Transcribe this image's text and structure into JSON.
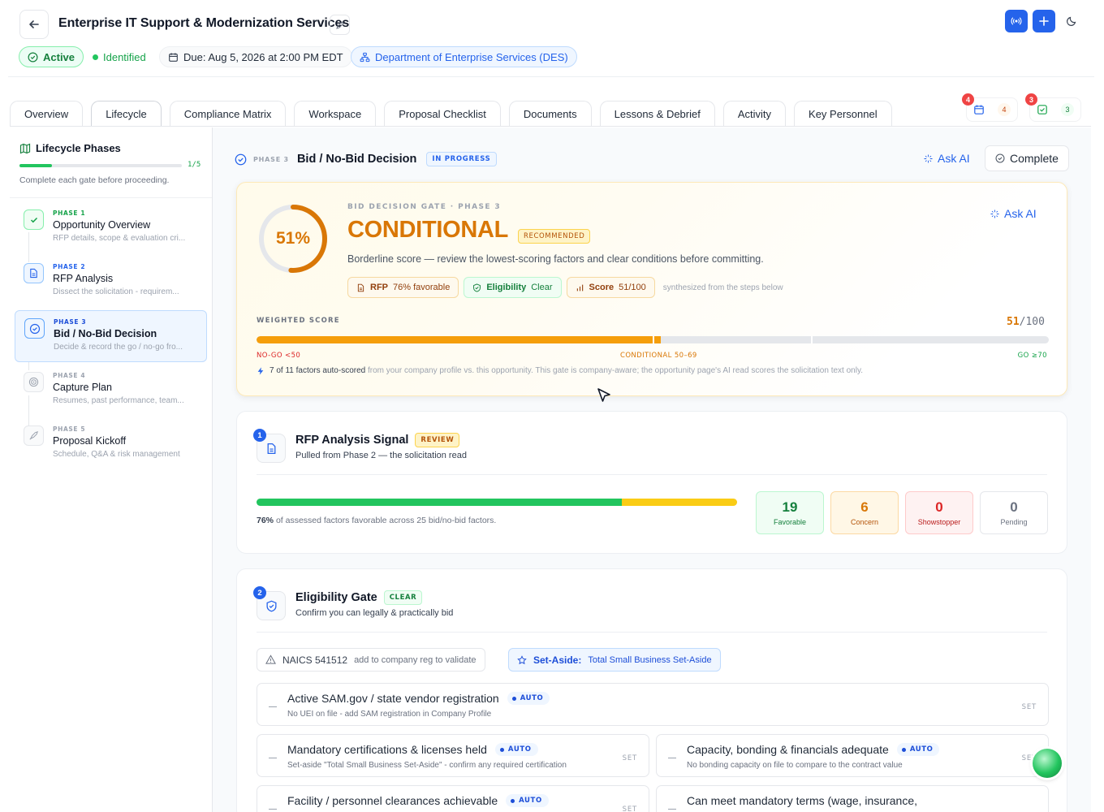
{
  "header": {
    "title": "Enterprise IT Support & Modernization Services",
    "status_active": "Active",
    "status_identified": "Identified",
    "due": "Due: Aug 5, 2026 at 2:00 PM EDT",
    "agency": "Department of Enterprise Services (DES)"
  },
  "tabs": [
    {
      "label": "Overview"
    },
    {
      "label": "Lifecycle",
      "active": true
    },
    {
      "label": "Compliance Matrix"
    },
    {
      "label": "Workspace"
    },
    {
      "label": "Proposal Checklist"
    },
    {
      "label": "Documents"
    },
    {
      "label": "Lessons & Debrief"
    },
    {
      "label": "Activity"
    },
    {
      "label": "Key Personnel"
    }
  ],
  "toolbar": {
    "calendar_badge": "4",
    "calendar_count": "4",
    "tasks_badge": "3",
    "tasks_count": "3"
  },
  "sidebar": {
    "title": "Lifecycle Phases",
    "progress_label": "1/5",
    "progress_fraction": 0.2,
    "hint": "Complete each gate before proceeding.",
    "phases": [
      {
        "num": "PHASE 1",
        "name": "Opportunity Overview",
        "desc": "RFP details, scope & evaluation cri...",
        "state": "done"
      },
      {
        "num": "PHASE 2",
        "name": "RFP Analysis",
        "desc": "Dissect the solicitation - requirem...",
        "state": "active"
      },
      {
        "num": "PHASE 3",
        "name": "Bid / No-Bid Decision",
        "desc": "Decide & record the go / no-go fro...",
        "state": "selected"
      },
      {
        "num": "PHASE 4",
        "name": "Capture Plan",
        "desc": "Resumes, past performance, team...",
        "state": "pending"
      },
      {
        "num": "PHASE 5",
        "name": "Proposal Kickoff",
        "desc": "Schedule, Q&A & risk management",
        "state": "pending"
      }
    ]
  },
  "main": {
    "phase_tag": "PHASE 3",
    "title": "Bid / No-Bid Decision",
    "status_badge": "IN PROGRESS",
    "ask_ai": "Ask AI",
    "complete": "Complete"
  },
  "gate": {
    "score_pct": 51,
    "score_label": "51%",
    "eyebrow": "BID DECISION GATE · PHASE 3",
    "verdict": "CONDITIONAL",
    "recommended": "RECOMMENDED",
    "note": "Borderline score — review the lowest-scoring factors and clear conditions before committing.",
    "ask_ai": "Ask AI",
    "chips": {
      "rfp_label": "RFP",
      "rfp_value": "76% favorable",
      "elig_label": "Eligibility",
      "elig_value": "Clear",
      "score_label": "Score",
      "score_value": "51/100"
    },
    "synth": "synthesized from the steps below",
    "weighted_label": "WEIGHTED SCORE",
    "weighted_value": "51",
    "weighted_max": "/100",
    "weighted_fraction": 0.51,
    "seg_nogo": "NO-GO <50",
    "seg_cond": "CONDITIONAL 50–69",
    "seg_go": "GO ≥70",
    "foot_strong": "7 of 11 factors auto-scored",
    "foot_rest": "from your company profile vs. this opportunity. This gate is company-aware; the opportunity page's AI read scores the solicitation text only."
  },
  "rfp": {
    "num": "1",
    "title": "RFP Analysis Signal",
    "badge": "REVIEW",
    "sub": "Pulled from Phase 2 — the solicitation read",
    "favorable_fraction": 0.76,
    "concern_fraction": 0.24,
    "foot_strong": "76%",
    "foot_rest": "of assessed factors favorable across 25 bid/no-bid factors.",
    "stats": [
      {
        "value": "19",
        "label": "Favorable"
      },
      {
        "value": "6",
        "label": "Concern"
      },
      {
        "value": "0",
        "label": "Showstopper"
      },
      {
        "value": "0",
        "label": "Pending"
      }
    ]
  },
  "eligibility": {
    "num": "2",
    "title": "Eligibility Gate",
    "badge": "CLEAR",
    "sub": "Confirm you can legally & practically bid",
    "naics_label": "NAICS 541512",
    "naics_hint": "add to company reg to validate",
    "setaside_label": "Set-Aside:",
    "setaside_value": "Total Small Business Set-Aside",
    "auto": "AUTO",
    "set": "SET",
    "rows": [
      {
        "title": "Active SAM.gov / state vendor registration",
        "desc": "No UEI on file - add SAM registration in Company Profile"
      },
      {
        "title": "Mandatory certifications & licenses held",
        "desc": "Set-aside \"Total Small Business Set-Aside\" - confirm any required certification"
      },
      {
        "title": "Capacity, bonding & financials adequate",
        "desc": "No bonding capacity on file to compare to the contract value"
      },
      {
        "title": "Facility / personnel clearances achievable",
        "desc": ""
      },
      {
        "title": "Can meet mandatory terms (wage, insurance,",
        "desc": ""
      }
    ]
  },
  "colors": {
    "accent": "#2563eb",
    "amber": "#d97706",
    "green": "#22c55e",
    "red": "#dc2626"
  }
}
